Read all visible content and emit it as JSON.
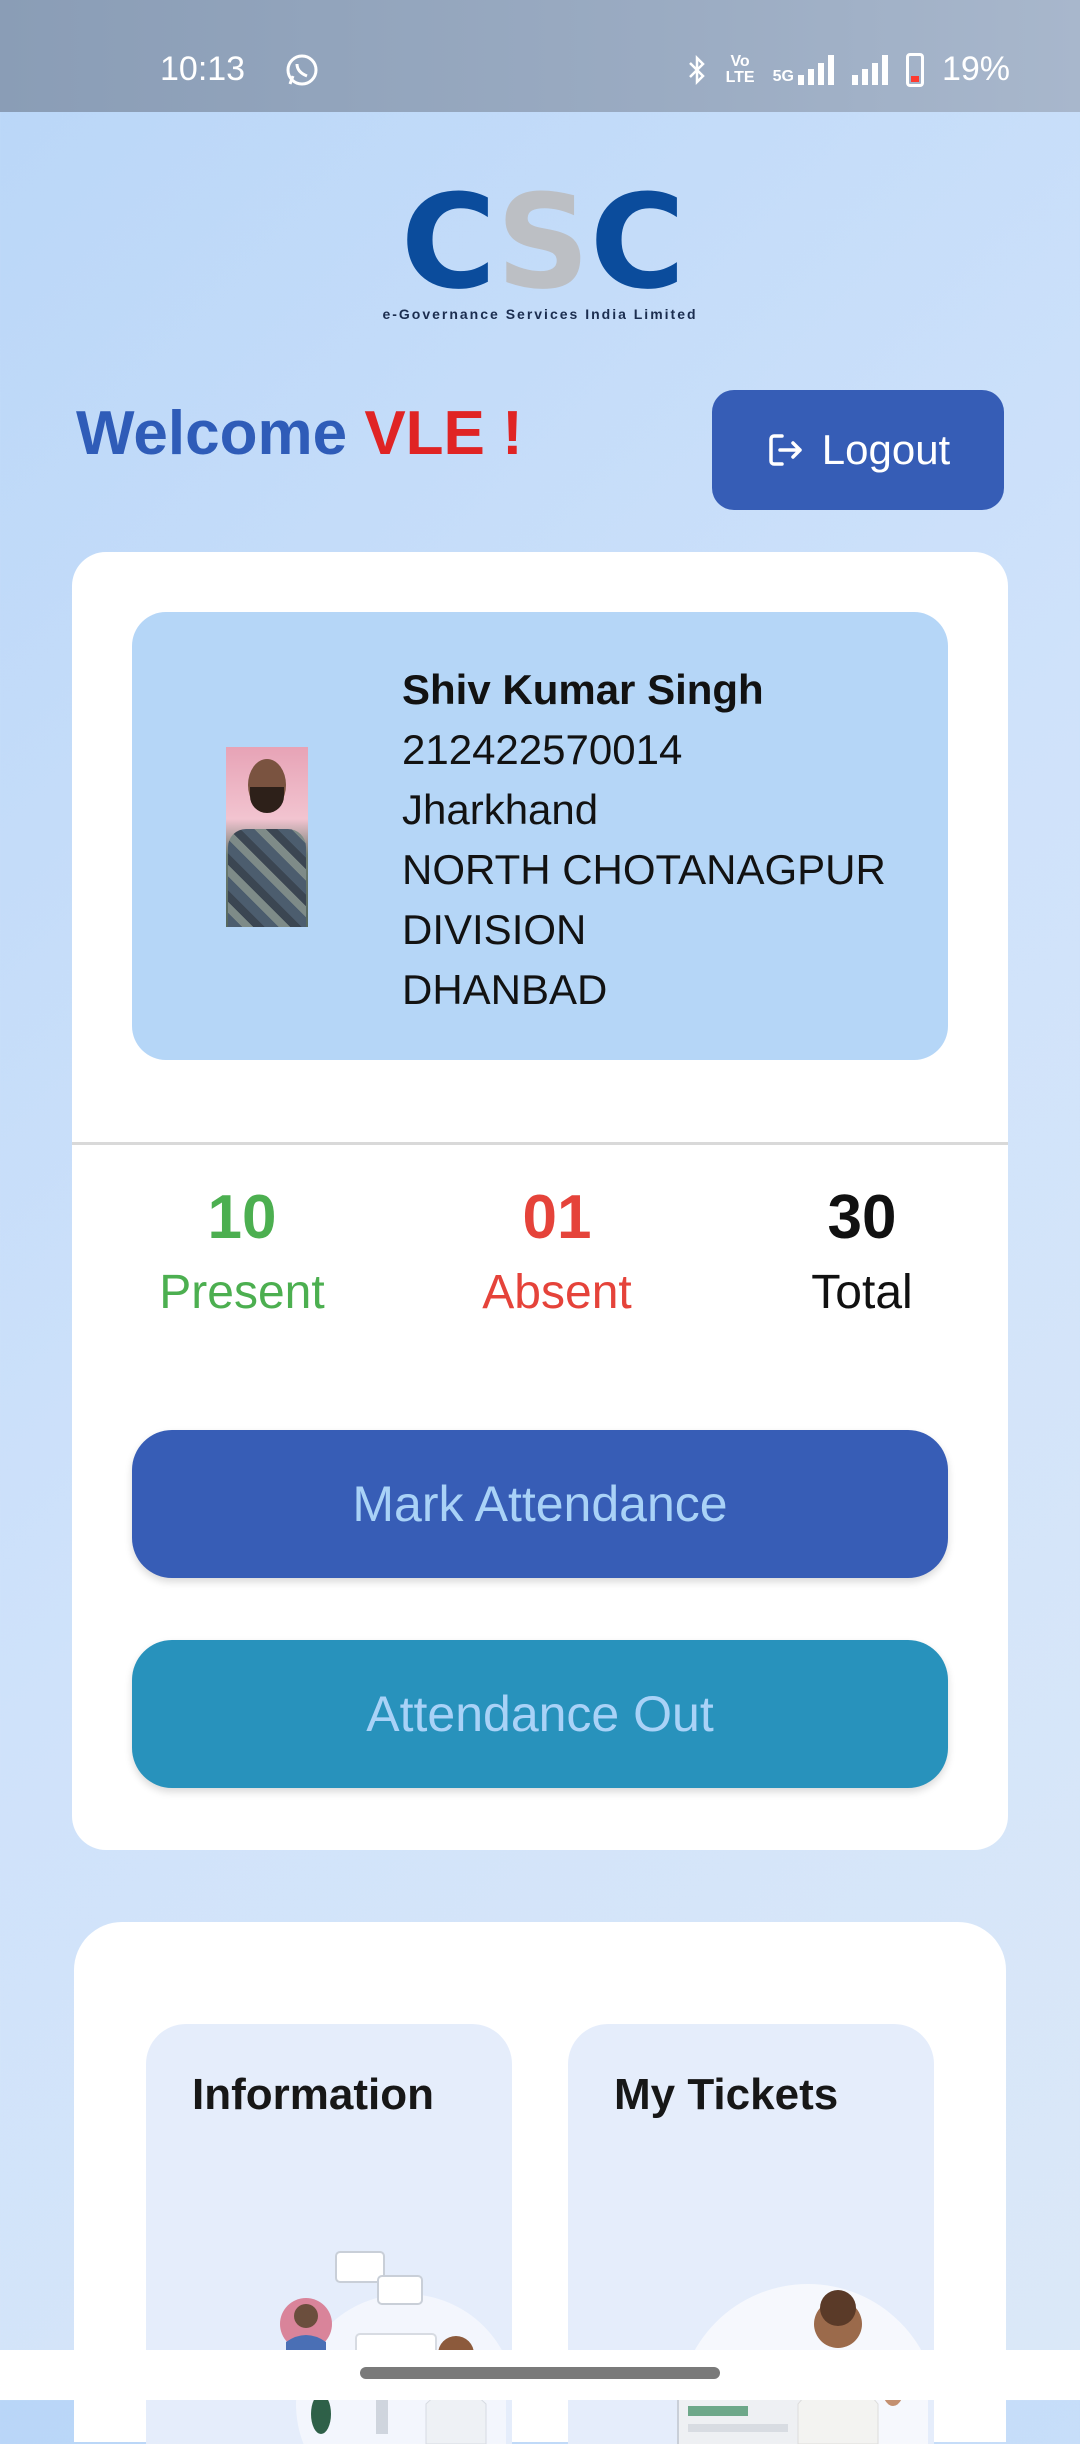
{
  "status_bar": {
    "time": "10:13",
    "battery": "19%",
    "network_5g": "5G",
    "volte_top": "Vo",
    "volte_bottom": "LTE",
    "icons": [
      "whatsapp-icon",
      "bluetooth-icon",
      "volte-icon",
      "signal-5g-icon",
      "signal-icon",
      "battery-icon"
    ]
  },
  "logo": {
    "letters": [
      "C",
      "S",
      "C"
    ],
    "tagline": "e-Governance Services India Limited"
  },
  "header": {
    "welcome": "Welcome",
    "user": "VLE !",
    "logout_label": "Logout",
    "colors": {
      "welcome": "#2f5cb8",
      "user": "#e02424",
      "logout_bg": "#365db6"
    }
  },
  "profile": {
    "name": "Shiv Kumar Singh",
    "id": "212422570014",
    "state": "Jharkhand",
    "division_line1": "NORTH CHOTANAGPUR",
    "division_line2": "DIVISION",
    "district": "DHANBAD"
  },
  "stats": {
    "present": {
      "value": "10",
      "label": "Present",
      "color": "#4caf50"
    },
    "absent": {
      "value": "01",
      "label": "Absent",
      "color": "#e5433a"
    },
    "total": {
      "value": "30",
      "label": "Total",
      "color": "#111111"
    }
  },
  "actions": {
    "mark_attendance": "Mark Attendance",
    "attendance_out": "Attendance Out",
    "colors": {
      "mark": "#375db6",
      "out": "#2892bc"
    }
  },
  "tiles": [
    {
      "title": "Information",
      "icon": "information-illustration"
    },
    {
      "title": "My Tickets",
      "icon": "tickets-illustration"
    }
  ]
}
